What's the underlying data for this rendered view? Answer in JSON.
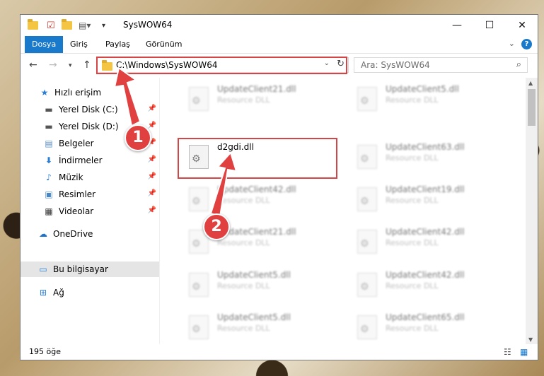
{
  "window": {
    "title": "SysWOW64",
    "controls": {
      "minimize": "—",
      "maximize": "☐",
      "close": "✕"
    }
  },
  "ribbon": {
    "tabs": [
      "Dosya",
      "Giriş",
      "Paylaş",
      "Görünüm"
    ],
    "active_tab": "Dosya",
    "help": "?"
  },
  "nav": {
    "address": "C:\\Windows\\SysWOW64",
    "search_placeholder": "Ara: SysWOW64"
  },
  "sidebar": {
    "items": [
      {
        "label": "Hızlı erişim",
        "icon": "star-icon",
        "pinned": false
      },
      {
        "label": "Yerel Disk (C:)",
        "icon": "drive-icon",
        "pinned": true
      },
      {
        "label": "Yerel Disk (D:)",
        "icon": "drive-icon",
        "pinned": true
      },
      {
        "label": "Belgeler",
        "icon": "documents-icon",
        "pinned": true
      },
      {
        "label": "İndirmeler",
        "icon": "download-icon",
        "pinned": true
      },
      {
        "label": "Müzik",
        "icon": "music-icon",
        "pinned": true
      },
      {
        "label": "Resimler",
        "icon": "pictures-icon",
        "pinned": true
      },
      {
        "label": "Videolar",
        "icon": "video-icon",
        "pinned": true
      },
      {
        "label": "OneDrive",
        "icon": "cloud-icon",
        "pinned": false
      },
      {
        "label": "Bu bilgisayar",
        "icon": "computer-icon",
        "pinned": false,
        "selected": true
      },
      {
        "label": "Ağ",
        "icon": "network-icon",
        "pinned": false
      }
    ]
  },
  "files": {
    "left": [
      {
        "name": "UpdateClient21.dll",
        "type": "Resource DLL"
      },
      {
        "name": "d2gdi.dll",
        "type": "",
        "highlighted": true
      },
      {
        "name": "UpdateClient42.dll",
        "type": "Resource DLL"
      },
      {
        "name": "UpdateClient21.dll",
        "type": "Resource DLL"
      },
      {
        "name": "UpdateClient5.dll",
        "type": "Resource DLL"
      },
      {
        "name": "UpdateClient5.dll",
        "type": "Resource DLL"
      }
    ],
    "right": [
      {
        "name": "UpdateClient5.dll",
        "type": "Resource DLL"
      },
      {
        "name": "UpdateClient63.dll",
        "type": "Resource DLL"
      },
      {
        "name": "UpdateClient19.dll",
        "type": "Resource DLL"
      },
      {
        "name": "UpdateClient42.dll",
        "type": "Resource DLL"
      },
      {
        "name": "UpdateClient42.dll",
        "type": "Resource DLL"
      },
      {
        "name": "UpdateClient65.dll",
        "type": "Resource DLL"
      }
    ]
  },
  "status": {
    "count": "195 öğe"
  },
  "annotations": {
    "badge1": "1",
    "badge2": "2",
    "color": "#e04040"
  }
}
